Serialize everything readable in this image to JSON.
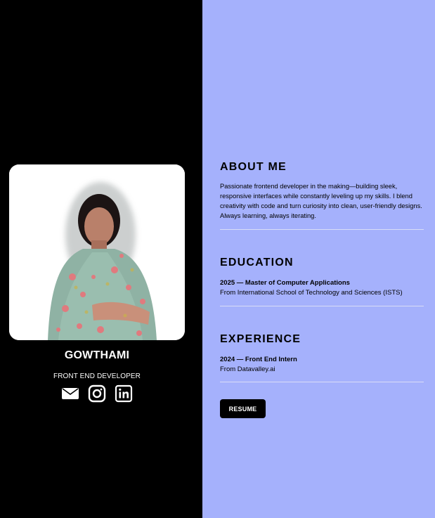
{
  "profile": {
    "name": "GOWTHAMI",
    "role": "FRONT END DEVELOPER",
    "socials": [
      {
        "icon": "envelope-icon"
      },
      {
        "icon": "instagram-icon"
      },
      {
        "icon": "linkedin-icon"
      }
    ]
  },
  "about": {
    "heading": "ABOUT ME",
    "text": "Passionate frontend developer in the making—building sleek, responsive interfaces while constantly leveling up my skills. I blend creativity with code and turn curiosity into clean, user-friendly designs. Always learning, always iterating."
  },
  "education": {
    "heading": "EDUCATION",
    "title": "2025 — Master of Computer Applications",
    "subtitle": "From International School of Technology and Sciences (ISTS)"
  },
  "experience": {
    "heading": "EXPERIENCE",
    "title": "2024 — Front End Intern",
    "subtitle": "From Datavalley.ai"
  },
  "resume_button": "RESUME",
  "colors": {
    "left_panel": "#000000",
    "right_panel": "#a5b1fc",
    "button": "#000000"
  }
}
